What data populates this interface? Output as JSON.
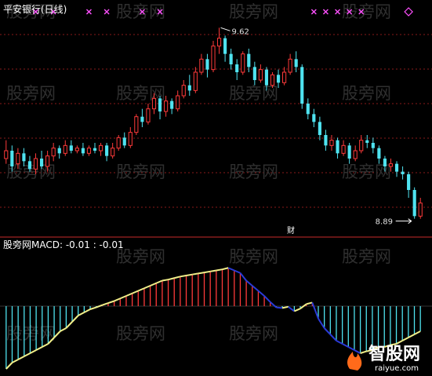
{
  "title": "平安银行(日线)",
  "watermark": "股旁网",
  "badge": "财",
  "macd_text": "MACD: -0.01   : -0.01",
  "indicator_label": "股旁网",
  "logo": {
    "cn": "智股网",
    "url": "raiyue.com"
  },
  "colors": {
    "up": "#ff3a3a",
    "down": "#4fe3f0",
    "grid": "#8a1a1a",
    "border": "#c82a2a",
    "signal_up": "#ff50ff",
    "signal_down": "#ff50ff",
    "dif_up": "#2a3ad8",
    "dif_down": "#f2f08a"
  },
  "chart_data": [
    {
      "type": "candlestick",
      "title": "平安银行(日线)",
      "annotations": [
        {
          "text": "9.62",
          "value": 9.62
        },
        {
          "text": "8.89",
          "value": 8.89
        }
      ],
      "ylim": [
        8.85,
        9.66
      ],
      "candles": [
        {
          "o": 9.12,
          "c": 9.15,
          "h": 9.19,
          "l": 9.1
        },
        {
          "o": 9.15,
          "c": 9.09,
          "h": 9.17,
          "l": 9.07
        },
        {
          "o": 9.1,
          "c": 9.14,
          "h": 9.16,
          "l": 9.08
        },
        {
          "o": 9.14,
          "c": 9.11,
          "h": 9.16,
          "l": 9.09
        },
        {
          "o": 9.11,
          "c": 9.08,
          "h": 9.13,
          "l": 9.07
        },
        {
          "o": 9.08,
          "c": 9.12,
          "h": 9.14,
          "l": 9.06
        },
        {
          "o": 9.12,
          "c": 9.09,
          "h": 9.15,
          "l": 9.08
        },
        {
          "o": 9.09,
          "c": 9.13,
          "h": 9.15,
          "l": 9.07
        },
        {
          "o": 9.13,
          "c": 9.16,
          "h": 9.18,
          "l": 9.11
        },
        {
          "o": 9.16,
          "c": 9.14,
          "h": 9.17,
          "l": 9.12
        },
        {
          "o": 9.14,
          "c": 9.17,
          "h": 9.19,
          "l": 9.13
        },
        {
          "o": 9.17,
          "c": 9.15,
          "h": 9.19,
          "l": 9.14
        },
        {
          "o": 9.15,
          "c": 9.16,
          "h": 9.17,
          "l": 9.14
        },
        {
          "o": 9.16,
          "c": 9.14,
          "h": 9.18,
          "l": 9.13
        },
        {
          "o": 9.14,
          "c": 9.16,
          "h": 9.17,
          "l": 9.13
        },
        {
          "o": 9.16,
          "c": 9.15,
          "h": 9.18,
          "l": 9.14
        },
        {
          "o": 9.15,
          "c": 9.17,
          "h": 9.18,
          "l": 9.13
        },
        {
          "o": 9.17,
          "c": 9.13,
          "h": 9.18,
          "l": 9.11
        },
        {
          "o": 9.13,
          "c": 9.16,
          "h": 9.18,
          "l": 9.12
        },
        {
          "o": 9.16,
          "c": 9.2,
          "h": 9.21,
          "l": 9.15
        },
        {
          "o": 9.2,
          "c": 9.17,
          "h": 9.22,
          "l": 9.16
        },
        {
          "o": 9.17,
          "c": 9.22,
          "h": 9.24,
          "l": 9.16
        },
        {
          "o": 9.22,
          "c": 9.28,
          "h": 9.29,
          "l": 9.21
        },
        {
          "o": 9.28,
          "c": 9.26,
          "h": 9.31,
          "l": 9.24
        },
        {
          "o": 9.26,
          "c": 9.31,
          "h": 9.33,
          "l": 9.25
        },
        {
          "o": 9.31,
          "c": 9.35,
          "h": 9.37,
          "l": 9.29
        },
        {
          "o": 9.35,
          "c": 9.3,
          "h": 9.36,
          "l": 9.27
        },
        {
          "o": 9.3,
          "c": 9.34,
          "h": 9.36,
          "l": 9.28
        },
        {
          "o": 9.34,
          "c": 9.31,
          "h": 9.35,
          "l": 9.29
        },
        {
          "o": 9.31,
          "c": 9.36,
          "h": 9.38,
          "l": 9.3
        },
        {
          "o": 9.36,
          "c": 9.4,
          "h": 9.42,
          "l": 9.35
        },
        {
          "o": 9.4,
          "c": 9.38,
          "h": 9.44,
          "l": 9.36
        },
        {
          "o": 9.38,
          "c": 9.45,
          "h": 9.47,
          "l": 9.37
        },
        {
          "o": 9.45,
          "c": 9.5,
          "h": 9.52,
          "l": 9.44
        },
        {
          "o": 9.5,
          "c": 9.46,
          "h": 9.52,
          "l": 9.43
        },
        {
          "o": 9.46,
          "c": 9.55,
          "h": 9.57,
          "l": 9.45
        },
        {
          "o": 9.55,
          "c": 9.58,
          "h": 9.62,
          "l": 9.52
        },
        {
          "o": 9.58,
          "c": 9.52,
          "h": 9.59,
          "l": 9.49
        },
        {
          "o": 9.52,
          "c": 9.48,
          "h": 9.54,
          "l": 9.46
        },
        {
          "o": 9.48,
          "c": 9.45,
          "h": 9.5,
          "l": 9.42
        },
        {
          "o": 9.45,
          "c": 9.52,
          "h": 9.53,
          "l": 9.44
        },
        {
          "o": 9.52,
          "c": 9.47,
          "h": 9.54,
          "l": 9.45
        },
        {
          "o": 9.47,
          "c": 9.42,
          "h": 9.49,
          "l": 9.4
        },
        {
          "o": 9.42,
          "c": 9.46,
          "h": 9.48,
          "l": 9.41
        },
        {
          "o": 9.46,
          "c": 9.4,
          "h": 9.47,
          "l": 9.38
        },
        {
          "o": 9.4,
          "c": 9.44,
          "h": 9.45,
          "l": 9.39
        },
        {
          "o": 9.44,
          "c": 9.41,
          "h": 9.46,
          "l": 9.39
        },
        {
          "o": 9.41,
          "c": 9.45,
          "h": 9.47,
          "l": 9.4
        },
        {
          "o": 9.45,
          "c": 9.5,
          "h": 9.52,
          "l": 9.44
        },
        {
          "o": 9.5,
          "c": 9.47,
          "h": 9.53,
          "l": 9.45
        },
        {
          "o": 9.47,
          "c": 9.33,
          "h": 9.48,
          "l": 9.31
        },
        {
          "o": 9.33,
          "c": 9.29,
          "h": 9.35,
          "l": 9.27
        },
        {
          "o": 9.29,
          "c": 9.26,
          "h": 9.31,
          "l": 9.24
        },
        {
          "o": 9.26,
          "c": 9.21,
          "h": 9.28,
          "l": 9.19
        },
        {
          "o": 9.21,
          "c": 9.17,
          "h": 9.23,
          "l": 9.15
        },
        {
          "o": 9.17,
          "c": 9.19,
          "h": 9.21,
          "l": 9.15
        },
        {
          "o": 9.19,
          "c": 9.14,
          "h": 9.2,
          "l": 9.12
        },
        {
          "o": 9.14,
          "c": 9.17,
          "h": 9.19,
          "l": 9.13
        },
        {
          "o": 9.17,
          "c": 9.12,
          "h": 9.18,
          "l": 9.1
        },
        {
          "o": 9.12,
          "c": 9.15,
          "h": 9.17,
          "l": 9.11
        },
        {
          "o": 9.15,
          "c": 9.19,
          "h": 9.21,
          "l": 9.14
        },
        {
          "o": 9.19,
          "c": 9.18,
          "h": 9.21,
          "l": 9.16
        },
        {
          "o": 9.18,
          "c": 9.16,
          "h": 9.2,
          "l": 9.14
        },
        {
          "o": 9.16,
          "c": 9.12,
          "h": 9.17,
          "l": 9.1
        },
        {
          "o": 9.12,
          "c": 9.09,
          "h": 9.13,
          "l": 9.07
        },
        {
          "o": 9.09,
          "c": 9.1,
          "h": 9.12,
          "l": 9.07
        },
        {
          "o": 9.1,
          "c": 9.07,
          "h": 9.11,
          "l": 9.05
        },
        {
          "o": 9.07,
          "c": 9.06,
          "h": 9.09,
          "l": 9.04
        },
        {
          "o": 9.06,
          "c": 9.0,
          "h": 9.07,
          "l": 8.97
        },
        {
          "o": 9.0,
          "c": 8.9,
          "h": 9.01,
          "l": 8.89
        },
        {
          "o": 8.9,
          "c": 8.95,
          "h": 8.97,
          "l": 8.89
        }
      ],
      "signals": [
        {
          "type": "cross",
          "i": 5
        },
        {
          "type": "cross",
          "i": 8
        },
        {
          "type": "cross",
          "i": 14
        },
        {
          "type": "cross",
          "i": 17
        },
        {
          "type": "cross",
          "i": 23
        },
        {
          "type": "cross",
          "i": 26
        },
        {
          "type": "cross",
          "i": 52
        },
        {
          "type": "cross",
          "i": 54
        },
        {
          "type": "cross",
          "i": 56
        },
        {
          "type": "cross",
          "i": 58
        },
        {
          "type": "cross",
          "i": 60
        },
        {
          "type": "diamond",
          "i": 68
        }
      ]
    },
    {
      "type": "bar",
      "title": "MACD",
      "ylim": [
        -0.1,
        0.1
      ],
      "values": [
        -0.1,
        -0.09,
        -0.085,
        -0.08,
        -0.075,
        -0.07,
        -0.065,
        -0.06,
        -0.05,
        -0.04,
        -0.035,
        -0.025,
        -0.015,
        -0.01,
        -0.005,
        -0.002,
        0.002,
        0.006,
        0.01,
        0.015,
        0.02,
        0.025,
        0.03,
        0.035,
        0.04,
        0.045,
        0.05,
        0.052,
        0.055,
        0.058,
        0.06,
        0.062,
        0.064,
        0.066,
        0.068,
        0.07,
        0.072,
        0.075,
        0.07,
        0.065,
        0.05,
        0.04,
        0.03,
        0.02,
        0.008,
        -0.002,
        -0.003,
        -0.001,
        -0.008,
        -0.004,
        0.004,
        0.007,
        -0.02,
        -0.035,
        -0.045,
        -0.055,
        -0.06,
        -0.065,
        -0.07,
        -0.075,
        -0.072,
        -0.07,
        -0.065,
        -0.065,
        -0.062,
        -0.06,
        -0.055,
        -0.05,
        -0.045,
        -0.04
      ],
      "dif": [
        -0.1,
        -0.09,
        -0.085,
        -0.08,
        -0.075,
        -0.07,
        -0.065,
        -0.06,
        -0.05,
        -0.04,
        -0.035,
        -0.025,
        -0.015,
        -0.01,
        -0.005,
        -0.002,
        0.002,
        0.006,
        0.01,
        0.015,
        0.02,
        0.025,
        0.03,
        0.035,
        0.04,
        0.045,
        0.05,
        0.052,
        0.055,
        0.058,
        0.06,
        0.062,
        0.064,
        0.066,
        0.068,
        0.07,
        0.072,
        0.075,
        0.07,
        0.065,
        0.05,
        0.04,
        0.03,
        0.02,
        0.008,
        -0.002,
        -0.003,
        -0.001,
        -0.008,
        -0.004,
        0.004,
        0.007,
        -0.02,
        -0.035,
        -0.045,
        -0.055,
        -0.06,
        -0.065,
        -0.07,
        -0.075,
        -0.072,
        -0.07,
        -0.065,
        -0.065,
        -0.062,
        -0.06,
        -0.055,
        -0.05,
        -0.045,
        -0.04
      ]
    }
  ]
}
